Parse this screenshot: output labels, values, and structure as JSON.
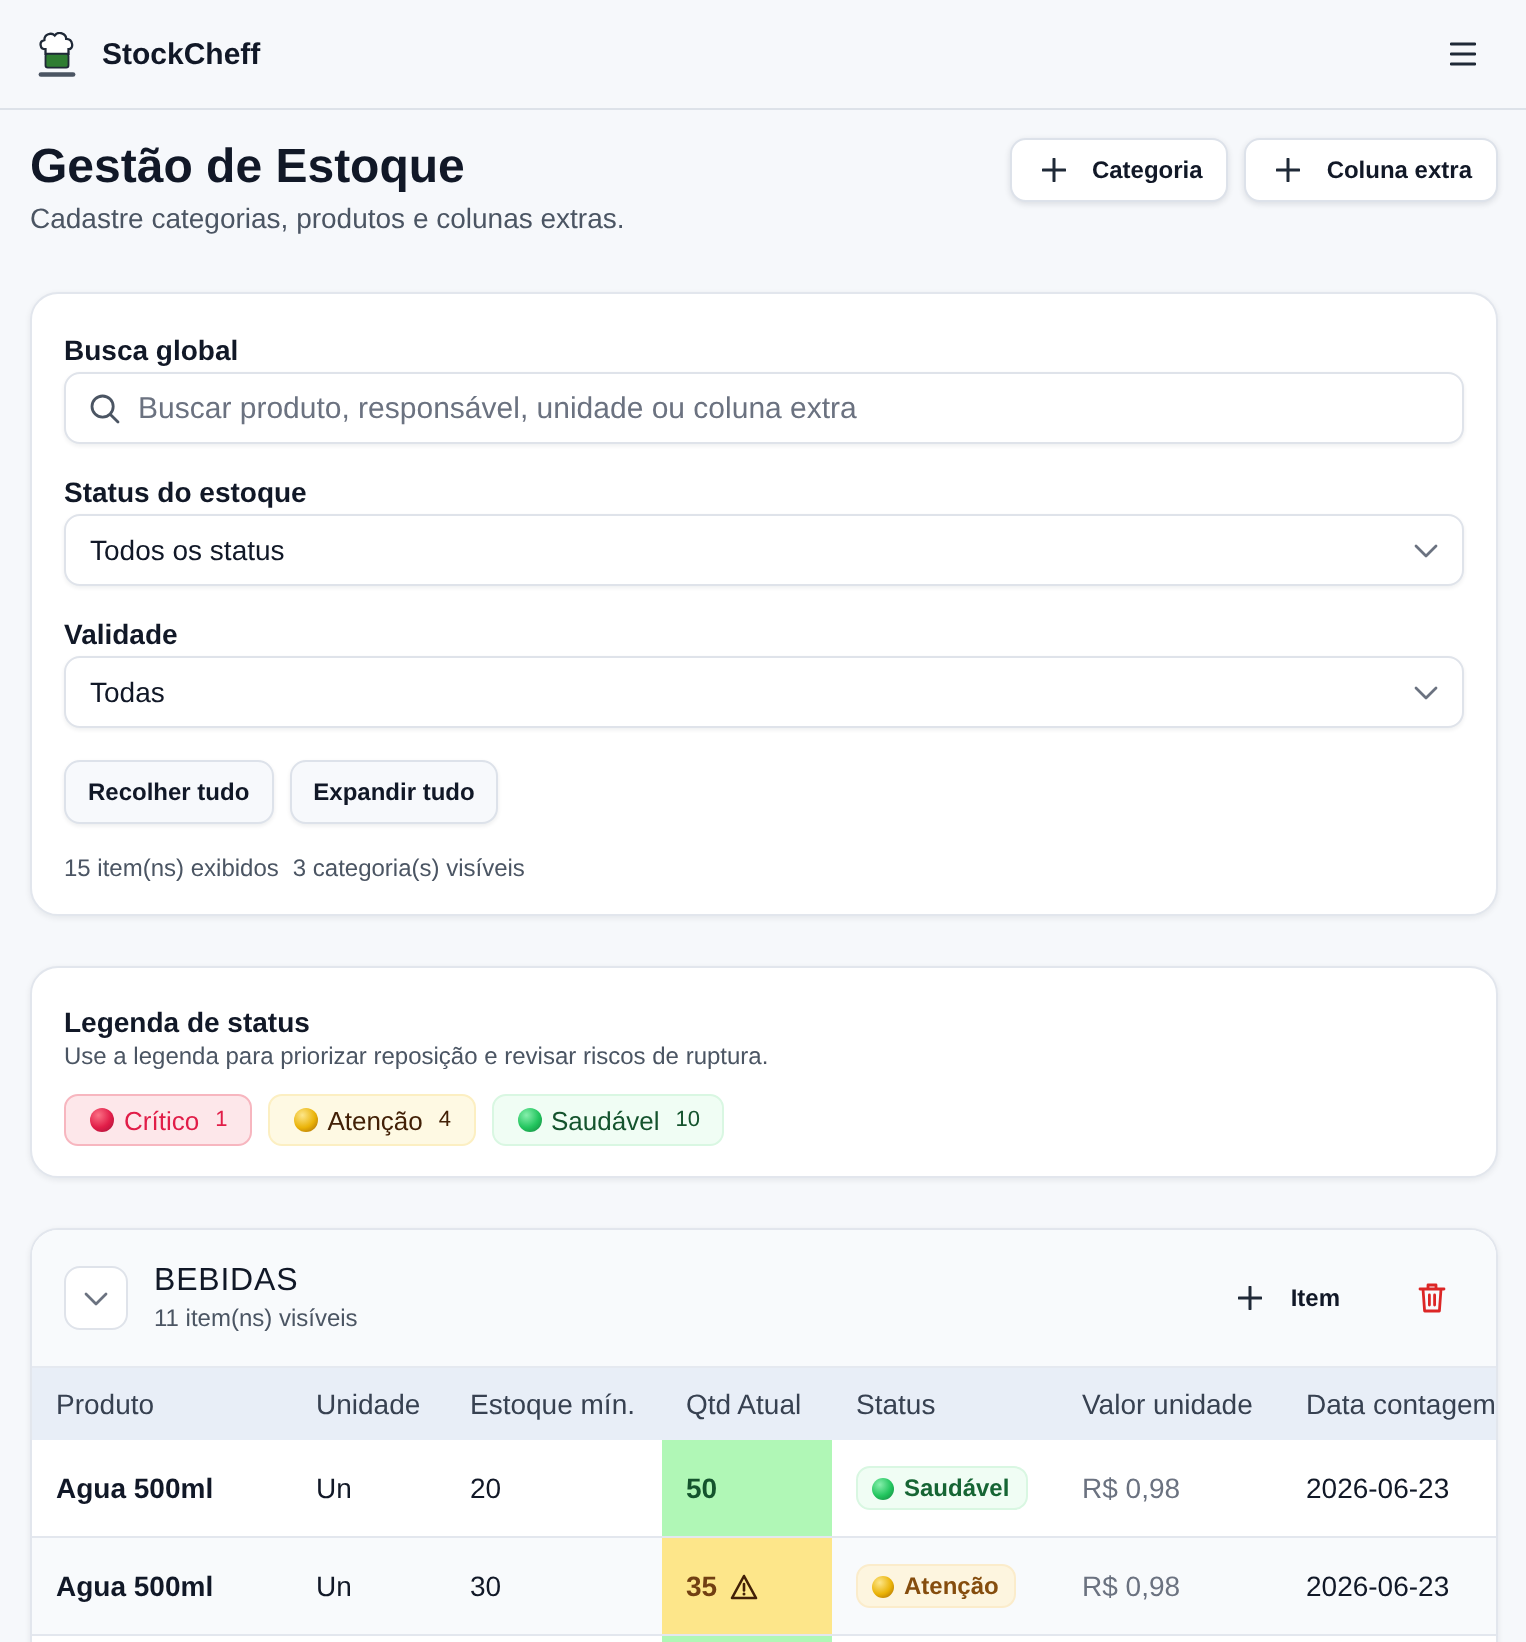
{
  "header": {
    "brand": "StockCheff"
  },
  "page": {
    "title": "Gestão de Estoque",
    "subtitle": "Cadastre categorias, produtos e colunas extras.",
    "actions": [
      "Categoria",
      "Coluna extra"
    ]
  },
  "filters": {
    "search": {
      "label": "Busca global",
      "placeholder": "Buscar produto, responsável, unidade ou coluna extra"
    },
    "selects": [
      {
        "label": "Status do estoque",
        "value": "Todos os status"
      },
      {
        "label": "Validade",
        "value": "Todas"
      }
    ],
    "buttons": [
      "Recolher tudo",
      "Expandir tudo"
    ],
    "summary": [
      "15 item(ns) exibidos",
      "3 categoria(s) visíveis"
    ]
  },
  "legend": {
    "title": "Legenda de status",
    "description": "Use a legenda para priorizar reposição e revisar riscos de ruptura.",
    "items": [
      {
        "kind": "critical",
        "label": "Crítico",
        "count": "1"
      },
      {
        "kind": "warning",
        "label": "Atenção",
        "count": "4"
      },
      {
        "kind": "healthy",
        "label": "Saudável",
        "count": "10"
      }
    ]
  },
  "categories": [
    {
      "name": "BEBIDAS",
      "count_text": "11 item(ns) visíveis",
      "expanded": true,
      "add_label": "Item",
      "table": {
        "columns": [
          "Produto",
          "Unidade",
          "Estoque mín.",
          "Qtd Atual",
          "Status",
          "Valor unidade",
          "Data contagem"
        ],
        "rows": [
          {
            "kind": "healthy",
            "product": "Agua 500ml",
            "unit": "Un",
            "min_stock": "20",
            "quantity": "50",
            "status_label": "Saudável",
            "unit_value": "R$ 0,98",
            "count_date": "2026-06-23"
          },
          {
            "kind": "warning",
            "product": "Agua 500ml",
            "unit": "Un",
            "min_stock": "30",
            "quantity": "35",
            "status_label": "Atenção",
            "unit_value": "R$ 0,98",
            "count_date": "2026-06-23"
          },
          {
            "kind": "healthy"
          }
        ]
      }
    }
  ]
}
